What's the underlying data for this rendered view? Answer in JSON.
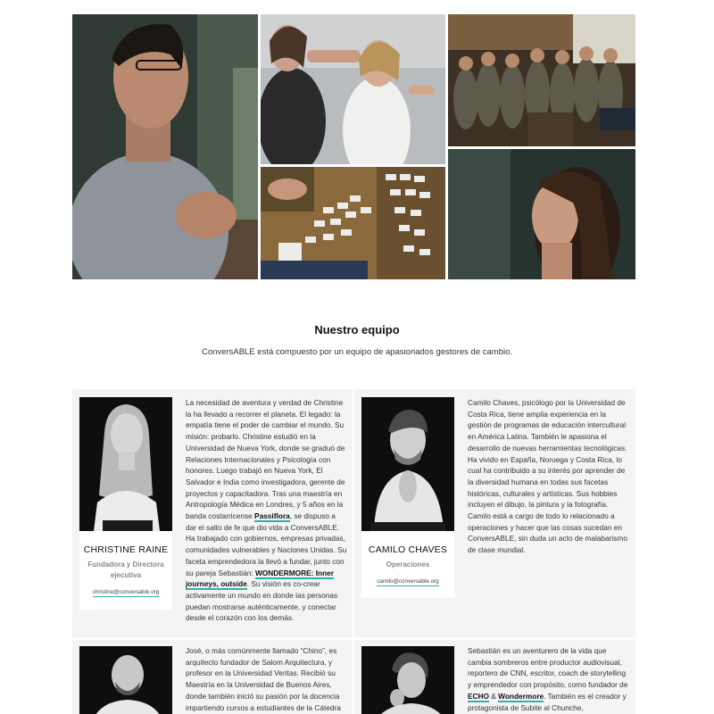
{
  "section": {
    "title": "Nuestro equipo",
    "subtitle": "ConversABLE está compuesto por un equipo de apasionados gestores de cambio."
  },
  "colors": {
    "accent": "#2bb3a3",
    "panel": "#f4f4f4"
  },
  "team": [
    {
      "name": "CHRISTINE RAINE",
      "role": "Fundadora y Directora ejecutiva",
      "email": "christine@conversable.org",
      "bio": {
        "p1": "La necesidad de aventura y verdad de Christine la ha llevado a recorrer el planeta. El legado: la empatía tiene el poder de cambiar el mundo. Su misión: probarlo. Christine estudió en la Universidad de Nueva York, donde se graduó de Relaciones Internacionales y Psicología con honores. Luego trabajó en Nueva York, El Salvador e India como investigadora, gerente de proyectos y capacitadora. Tras una maestría en Antropología Médica en Londres, y 5 años en la banda costarricense ",
        "link1": "Passiflora",
        "p2": ", se dispuso a dar el salto de fe que dio vida a ConversABLE. Ha trabajado con gobiernos, empresas privadas, comunidades vulnerables y Naciones Unidas. Su faceta emprendedora la llevó a fundar, junto con su pareja Sebastián: ",
        "link2": "WONDERMORE: Inner journeys, outside",
        "p3": ". Su visión es co-crear activamente un mundo en donde las personas puedan mostrarse auténticamente, y conectar desde el corazón con los demás."
      }
    },
    {
      "name": "CAMILO CHAVES",
      "role": "Operaciones",
      "email": "camilo@conversable.org",
      "bio": {
        "p1": "Camilo Chaves, psicólogo por la Universidad de Costa Rica, tiene amplia experiencia en la gestión de programas de educación intercultural en América Latina. También le apasiona el desarrollo de nuevas herramientas tecnológicas. Ha vivido en España, Noruega y Costa Rica, lo cual ha contribuido a su interés por aprender de la diversidad humana en todas sus facetas históricas, culturales y artísticas. Sus hobbies incluyen el dibujo, la pintura y la fotografía. Camilo está a cargo de todo lo relacionado a operaciones y hacer que las cosas sucedan en ConversABLE, sin duda un acto de malabarismo de clase mundial."
      }
    },
    {
      "bio": {
        "p1": "José, o más comúnmente llamado “Chino”, es arquitecto fundador de Salom Arquitectura, y profesor en la Universidad Veritas. Recibió su Maestría en la Universidad de Buenos Aires, donde también inició su pasión por la docencia impartiendo cursos a estudiantes de la Cátedra"
      }
    },
    {
      "bio": {
        "p1": "Sebastián es un aventurero de la vida que cambia sombreros entre productor audiovisual, reportero de CNN, escritor, coach de storytelling y emprendedor con propósito, como fundador de ",
        "link1": "ECHO",
        "p2": " & ",
        "link2": "Wondermore",
        "p3": ". También es el creador y protagonista de Subite al Chunche,"
      }
    }
  ]
}
